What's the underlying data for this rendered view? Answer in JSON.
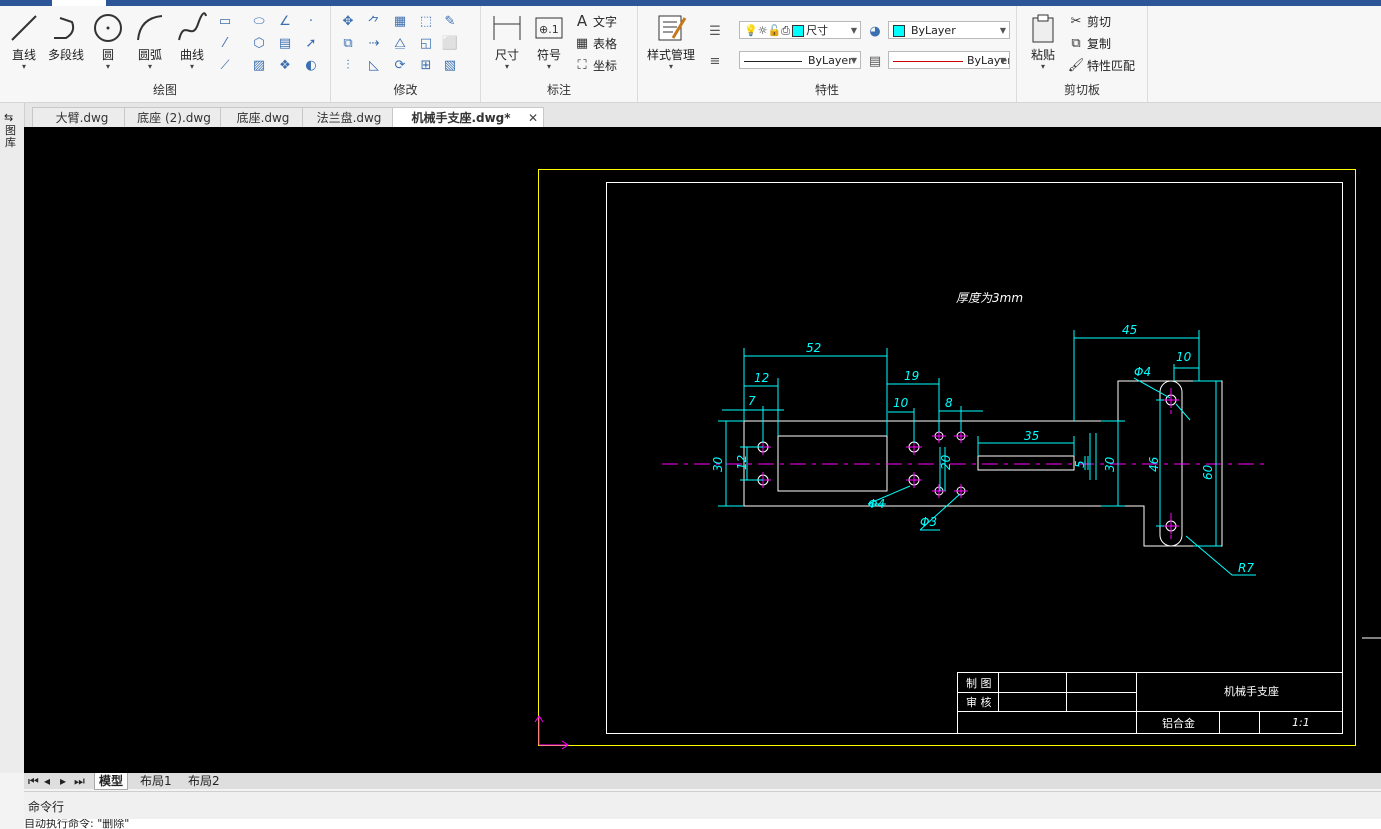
{
  "ribbon": {
    "draw": {
      "title": "绘图",
      "line": "直线",
      "polyline": "多段线",
      "circle": "圆",
      "arc": "圆弧",
      "curve": "曲线"
    },
    "modify": {
      "title": "修改"
    },
    "annotation": {
      "title": "标注",
      "dimension": "尺寸",
      "symbol": "符号",
      "text": "文字",
      "table": "表格",
      "coordinate": "坐标"
    },
    "properties": {
      "title": "特性",
      "style_manager": "样式管理",
      "layer_name": "尺寸",
      "color": "ByLayer",
      "color_swatch": "#00ffff",
      "linetype": "ByLayer",
      "lineweight": "ByLayer"
    },
    "clipboard": {
      "title": "剪切板",
      "paste": "粘贴",
      "cut": "剪切",
      "copy": "复制",
      "match": "特性匹配"
    }
  },
  "file_tabs": [
    {
      "label": "大臂.dwg",
      "active": false
    },
    {
      "label": "底座 (2).dwg",
      "active": false
    },
    {
      "label": "底座.dwg",
      "active": false
    },
    {
      "label": "法兰盘.dwg",
      "active": false
    },
    {
      "label": "机械手支座.dwg*",
      "active": true
    }
  ],
  "left_panel_label": "图库",
  "drawing": {
    "note": "厚度为3mm",
    "dims": {
      "d52": "52",
      "d12a": "12",
      "d7": "7",
      "d19": "19",
      "d10a": "10",
      "d8": "8",
      "d35": "35",
      "d45": "45",
      "d10b": "10",
      "d30a": "30",
      "d12b": "12",
      "d20": "20",
      "d5": "5",
      "d30b": "30",
      "d46": "46",
      "d60": "60",
      "phi4a": "Φ4",
      "phi4b": "Φ4",
      "phi3": "Φ3",
      "r7": "R7"
    },
    "title_block": {
      "draw_label": "制 图",
      "check_label": "审 核",
      "part_name": "机械手支座",
      "material": "铝合金",
      "scale": "1:1"
    }
  },
  "layout_tabs": {
    "model": "模型",
    "layout1": "布局1",
    "layout2": "布局2"
  },
  "command": {
    "title": "命令行",
    "last_line": "自动执行命令: \"删除\""
  },
  "colors": {
    "cad_background": "#000000",
    "layout_border": "#ffff00",
    "dimension": "#00ffff",
    "centerline": "#ff00ff",
    "geometry": "#ffffff"
  }
}
